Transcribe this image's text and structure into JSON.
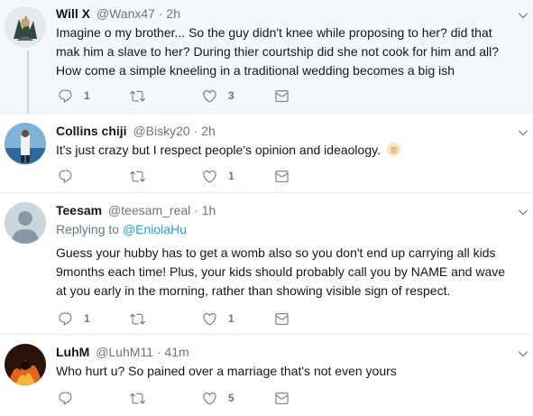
{
  "tweets": [
    {
      "display_name": "Will X",
      "handle": "@Wanx47",
      "separator": "·",
      "time": "2h",
      "reply_to_label": "",
      "reply_to_user": "",
      "text_lines": [
        "Imagine o my brother... So the guy didn't knee while proposing to her? did that",
        "mak him a slave to her? During thier courtship did she not cook for him and all?",
        "How come a simple kneeling in a traditional wedding becomes a big ish"
      ],
      "replies": "1",
      "retweets": "",
      "likes": "3"
    },
    {
      "display_name": "Collins chiji",
      "handle": "@Bisky20",
      "separator": "·",
      "time": "2h",
      "reply_to_label": "",
      "reply_to_user": "",
      "text_lines": [
        "It's just crazy but I respect people's opinion and ideaology."
      ],
      "emoji": "raised-fist-emoji",
      "replies": "",
      "retweets": "",
      "likes": "1"
    },
    {
      "display_name": "Teesam",
      "handle": "@teesam_real",
      "separator": "·",
      "time": "1h",
      "reply_to_label": "Replying to",
      "reply_to_user": "@EniolaHu",
      "text_lines": [
        "Guess your hubby has to get a womb also so you don't end up carrying all kids",
        "9months each time! Plus, your kids should probably call you by NAME and wave",
        "at you early in the morning, rather than showing visible sign of respect."
      ],
      "replies": "1",
      "retweets": "",
      "likes": "1"
    },
    {
      "display_name": "LuhM",
      "handle": "@LuhM11",
      "separator": "·",
      "time": "41m",
      "reply_to_label": "",
      "reply_to_user": "",
      "text_lines": [
        "Who hurt u? So pained over a marriage that's not even yours"
      ],
      "replies": "",
      "retweets": "",
      "likes": "5"
    }
  ],
  "icons": {
    "reply": "reply-icon",
    "retweet": "retweet-icon",
    "like": "heart-icon",
    "dm": "envelope-icon",
    "more": "chevron-down-icon"
  },
  "colors": {
    "highlight_bg": "#f5f8fa",
    "muted": "#657786",
    "link": "#1da1f2",
    "thread_line": "#ccd6dd",
    "divider": "#e6ecf0"
  }
}
